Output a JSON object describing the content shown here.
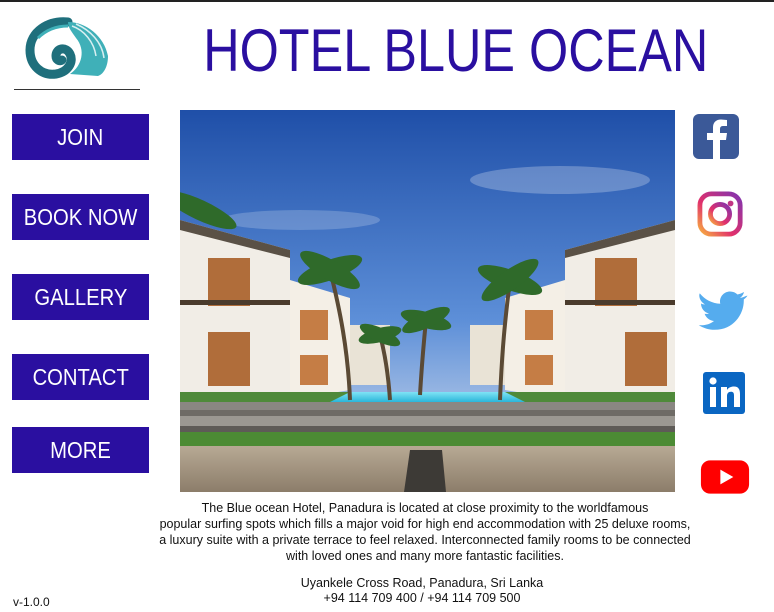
{
  "header": {
    "title": "HOTEL BLUE OCEAN",
    "logo_icon": "nautilus-shell-logo"
  },
  "nav": {
    "items": [
      {
        "label": "JOIN"
      },
      {
        "label": "BOOK NOW"
      },
      {
        "label": "GALLERY"
      },
      {
        "label": "CONTACT"
      },
      {
        "label": "MORE"
      }
    ]
  },
  "social": [
    {
      "icon": "facebook-icon"
    },
    {
      "icon": "instagram-icon"
    },
    {
      "icon": "twitter-icon"
    },
    {
      "icon": "linkedin-icon"
    },
    {
      "icon": "youtube-icon"
    }
  ],
  "description": {
    "lines": [
      "The Blue ocean Hotel, Panadura  is located at close proximity to the worldfamous",
      "popular surfing spots which fills a major void for high end accommodation with 25 deluxe rooms,",
      "a luxury suite with a private terrace to feel relaxed. Interconnected family rooms to be connected",
      "with loved ones and many more fantastic facilities."
    ]
  },
  "address": {
    "street": "Uyankele Cross Road, Panadura, Sri Lanka",
    "phone": "+94 114 709 400 / +94 114 709 500"
  },
  "footer": {
    "version": "v-1.0.0"
  },
  "colors": {
    "brand": "#2a0fa0",
    "teal": "#1f8b95"
  }
}
